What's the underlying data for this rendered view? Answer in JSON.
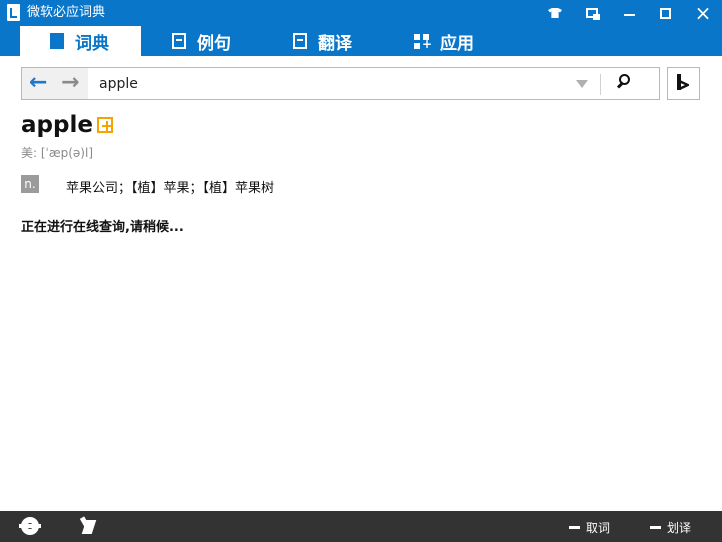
{
  "titlebar": {
    "title": "微软必应词典"
  },
  "tabs": [
    {
      "label": "词典",
      "active": true
    },
    {
      "label": "例句",
      "active": false
    },
    {
      "label": "翻译",
      "active": false
    },
    {
      "label": "应用",
      "active": false
    }
  ],
  "search": {
    "value": "apple"
  },
  "entry": {
    "headword": "apple",
    "phonetic": "美: [ˈæp(ə)l]",
    "pos": "n.",
    "definition": "苹果公司；【植】苹果；【植】苹果树"
  },
  "status": {
    "message": "正在进行在线查询,请稍候..."
  },
  "footer": {
    "option_1": "取词",
    "option_2": "划译"
  },
  "colors": {
    "brand_blue": "#0a76c9",
    "bottom_bar": "#333333",
    "accent_orange": "#f4a300"
  },
  "icons": {
    "app": "dictionary-app-icon",
    "skin": "shirt-icon",
    "mini_mode": "mini-window-icon",
    "minimize": "minimize-icon",
    "maximize": "maximize-icon",
    "close": "close-icon",
    "dictionary_tab": "book-icon",
    "examples_tab": "document-icon",
    "translate_tab": "translate-icon",
    "apps_tab": "apps-grid-icon",
    "back": "back-arrow-icon",
    "forward": "forward-arrow-icon",
    "dropdown": "dropdown-triangle-icon",
    "search": "search-icon",
    "bing": "bing-icon",
    "add_note": "add-note-icon",
    "settings": "gear-icon",
    "capture": "hand-icon"
  }
}
